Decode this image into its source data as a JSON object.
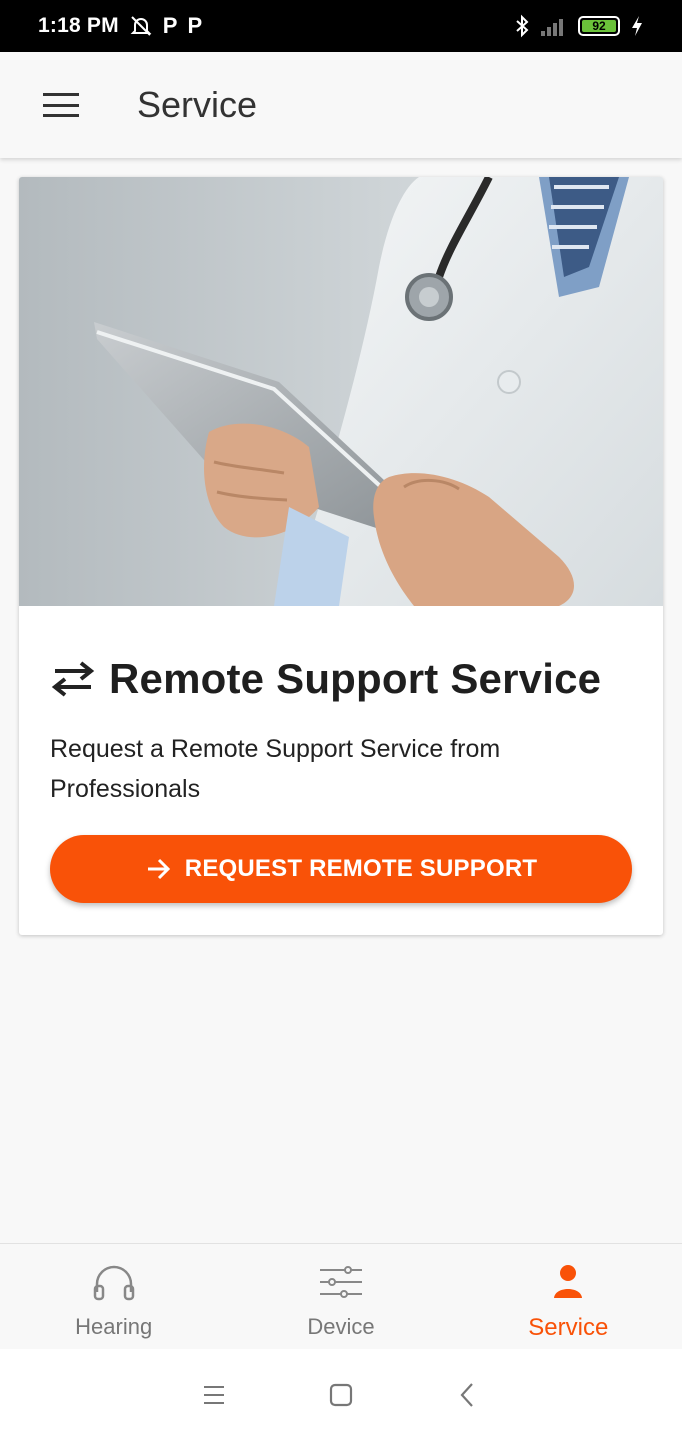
{
  "status_bar": {
    "time": "1:18 PM",
    "battery": "92",
    "icons": [
      "alarm-off-icon",
      "parking-app-icon",
      "parking-app-icon",
      "bluetooth-icon",
      "signal-icon",
      "battery-icon",
      "charging-icon"
    ]
  },
  "app_bar": {
    "title": "Service",
    "menu_icon": "hamburger-menu-icon"
  },
  "card": {
    "image_alt": "doctor holding a tablet",
    "title": "Remote Support Service",
    "title_icon": "swap-arrows-icon",
    "description": "Request a Remote Support Service from Professionals",
    "button_label": "REQUEST REMOTE SUPPORT",
    "button_icon": "arrow-right-icon"
  },
  "bottom_nav": {
    "items": [
      {
        "label": "Hearing",
        "icon": "headphones-icon",
        "active": false
      },
      {
        "label": "Device",
        "icon": "sliders-icon",
        "active": false
      },
      {
        "label": "Service",
        "icon": "person-icon",
        "active": true
      }
    ]
  },
  "system_nav": [
    "recents-icon",
    "home-icon",
    "back-icon"
  ],
  "colors": {
    "accent": "#f95208",
    "status_bar_bg": "#000000",
    "background": "#f8f8f8",
    "battery_green": "#6bc23a"
  }
}
